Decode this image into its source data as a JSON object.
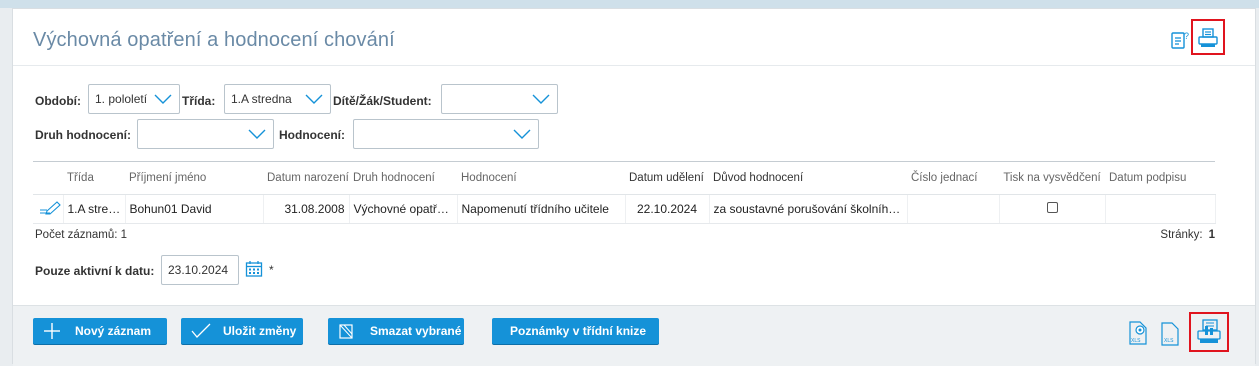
{
  "header": {
    "title": "Výchovná opatření a hodnocení chování",
    "icons": [
      "help-doc-icon",
      "print-icon"
    ]
  },
  "filters": {
    "period_label": "Období:",
    "period_value": "1. pololetí",
    "class_label": "Třída:",
    "class_value": "1.A stredna",
    "student_label": "Dítě/Žák/Student:",
    "student_value": "",
    "eval_type_label": "Druh hodnocení:",
    "eval_type_value": "",
    "eval_label": "Hodnocení:",
    "eval_value": ""
  },
  "table": {
    "columns": [
      "Třída",
      "Příjmení jméno",
      "Datum narození",
      "Druh hodnocení",
      "Hodnocení",
      "Datum udělení",
      "Důvod hodnocení",
      "Číslo jednací",
      "Tisk na vysvědčení",
      "Datum podpisu"
    ],
    "rows": [
      {
        "class": "1.A stre…",
        "name": "Bohun01 David",
        "birth": "31.08.2008",
        "type": "Výchovné opatření",
        "eval": "Napomenutí třídního učitele",
        "date": "22.10.2024",
        "reason": "za soustavné porušování školního …",
        "ref": "",
        "print": false,
        "sign": ""
      }
    ]
  },
  "summary": {
    "count_text": "Počet záznamů: 1",
    "pages_label": "Stránky:",
    "pages_value": "1"
  },
  "active_date": {
    "label": "Pouze aktivní k datu:",
    "value": "23.10.2024",
    "required_mark": "*"
  },
  "footer": {
    "new_label": "Nový záznam",
    "save_label": "Uložit změny",
    "delete_label": "Smazat vybrané",
    "notes_label": "Poznámky v třídní knize",
    "icons": [
      "xls-settings-icon",
      "xls-export-icon",
      "print-report-icon"
    ]
  },
  "colors": {
    "accent": "#1592d8",
    "title": "#6a8aa6",
    "highlight": "#e0141e"
  }
}
